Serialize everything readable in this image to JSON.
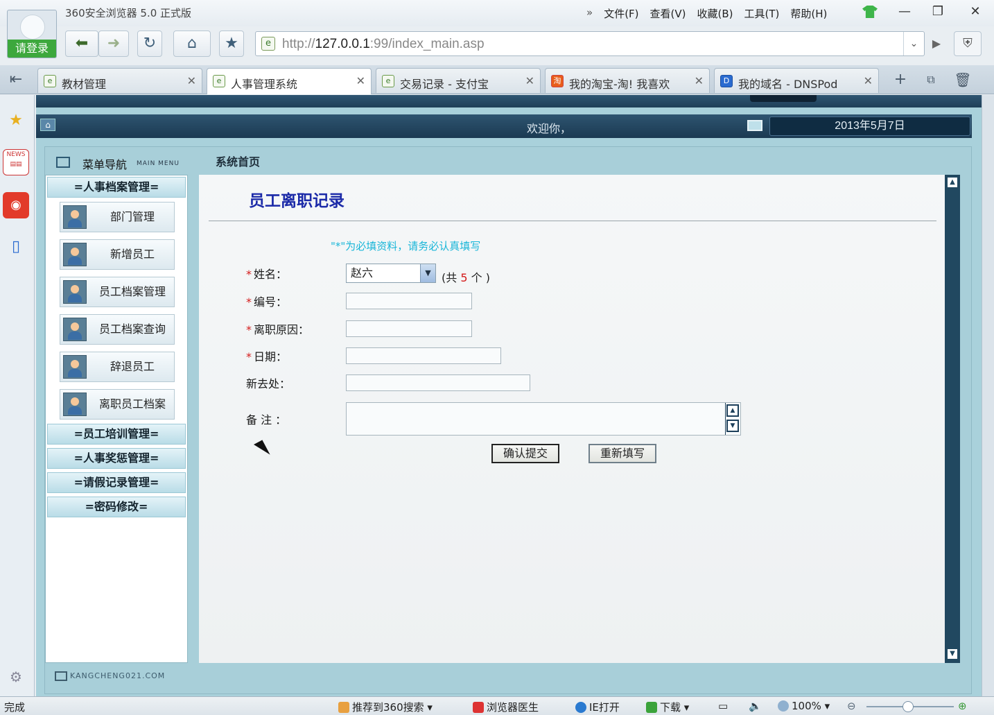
{
  "browser": {
    "title": "360安全浏览器 5.0 正式版",
    "menus": [
      "文件(F)",
      "查看(V)",
      "收藏(B)",
      "工具(T)",
      "帮助(H)"
    ],
    "login_label": "请登录",
    "url_prefix": "http://",
    "url_host": "127.0.0.1",
    "url_rest": ":99/index_main.asp",
    "tabs": [
      {
        "label": "教材管理",
        "icon": "ie-icon"
      },
      {
        "label": "人事管理系统",
        "icon": "ie-icon"
      },
      {
        "label": "交易记录 - 支付宝",
        "icon": "ie-icon"
      },
      {
        "label": "我的淘宝-淘! 我喜欢",
        "icon": "taobao-icon"
      },
      {
        "label": "我的域名 - DNSPod",
        "icon": "dnspod-icon"
      }
    ]
  },
  "app": {
    "welcome": "欢迎你，",
    "date": "2013年5月7日",
    "menu_title": "菜单导航",
    "menu_subtitle": "MAIN MENU",
    "home_title": "系统首页",
    "footer": "KANGCHENG021.COM",
    "groups": [
      {
        "label": "=人事档案管理="
      },
      {
        "label": "=员工培训管理="
      },
      {
        "label": "=人事奖惩管理="
      },
      {
        "label": "=请假记录管理="
      },
      {
        "label": "=密码修改="
      }
    ],
    "items": [
      {
        "label": "部门管理"
      },
      {
        "label": "新增员工"
      },
      {
        "label": "员工档案管理"
      },
      {
        "label": "员工档案查询"
      },
      {
        "label": "辞退员工"
      },
      {
        "label": "离职员工档案"
      }
    ]
  },
  "form": {
    "heading": "员工离职记录",
    "note": "\"*\"为必填资料，请务必认真填写",
    "name_label": "姓名：",
    "name_value": "赵六",
    "count_prefix": "(共",
    "count": "5",
    "count_suffix": "个 )",
    "id_label": "编号：",
    "reason_label": "离职原因：",
    "date_label": "日期：",
    "dest_label": "新去处：",
    "remark_label": "备 注 ：",
    "submit_label": "确认提交",
    "reset_label": "重新填写"
  },
  "status": {
    "left": "完成",
    "recommend": "推荐到360搜索",
    "doctor": "浏览器医生",
    "ie_open": "IE打开",
    "download": "下载",
    "zoom": "100%"
  },
  "colors": {
    "accent_heading": "#1b2aa8",
    "required_star": "#d41b1b",
    "note": "#19b6d8",
    "login_green": "#3da83d"
  }
}
